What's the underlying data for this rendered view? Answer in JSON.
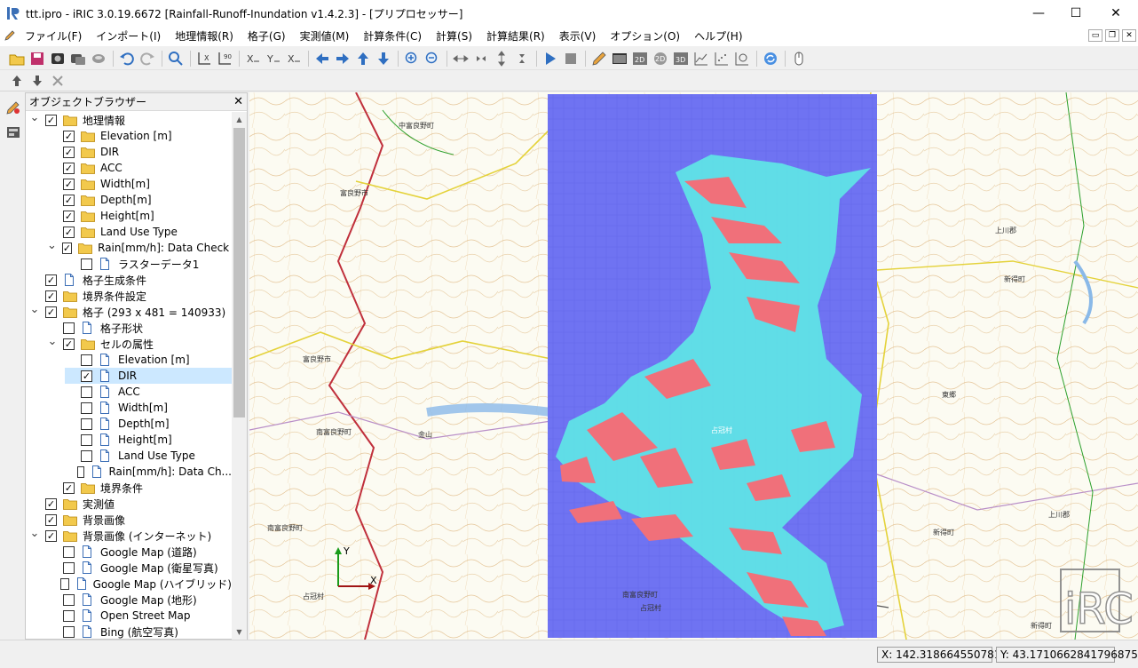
{
  "window": {
    "title": "ttt.ipro - iRIC 3.0.19.6672 [Rainfall-Runoff-Inundation v1.4.2.3] - [プリプロセッサー]",
    "controls": {
      "minimize": "—",
      "maximize": "☐",
      "close": "✕"
    }
  },
  "menu": [
    "ファイル(F)",
    "インポート(I)",
    "地理情報(R)",
    "格子(G)",
    "実測値(M)",
    "計算条件(C)",
    "計算(S)",
    "計算結果(R)",
    "表示(V)",
    "オプション(O)",
    "ヘルプ(H)"
  ],
  "object_browser": {
    "title": "オブジェクトブラウザー",
    "close": "✕",
    "items": [
      {
        "label": "地理情報",
        "level": 0,
        "expander": "v",
        "checked": true,
        "icon": "folder"
      },
      {
        "label": "Elevation [m]",
        "level": 1,
        "expander": "",
        "checked": true,
        "icon": "folder"
      },
      {
        "label": "DIR",
        "level": 1,
        "expander": "",
        "checked": true,
        "icon": "folder"
      },
      {
        "label": "ACC",
        "level": 1,
        "expander": "",
        "checked": true,
        "icon": "folder"
      },
      {
        "label": "Width[m]",
        "level": 1,
        "expander": "",
        "checked": true,
        "icon": "folder"
      },
      {
        "label": "Depth[m]",
        "level": 1,
        "expander": "",
        "checked": true,
        "icon": "folder"
      },
      {
        "label": "Height[m]",
        "level": 1,
        "expander": "",
        "checked": true,
        "icon": "folder"
      },
      {
        "label": "Land Use Type",
        "level": 1,
        "expander": "",
        "checked": true,
        "icon": "folder"
      },
      {
        "label": "Rain[mm/h]: Data Check ...",
        "level": 1,
        "expander": "v",
        "checked": true,
        "icon": "folder"
      },
      {
        "label": "ラスターデータ1",
        "level": 2,
        "expander": "",
        "checked": false,
        "icon": "file"
      },
      {
        "label": "格子生成条件",
        "level": 0,
        "expander": "",
        "checked": true,
        "icon": "file"
      },
      {
        "label": "境界条件設定",
        "level": 0,
        "expander": "",
        "checked": true,
        "icon": "folder"
      },
      {
        "label": "格子 (293 x 481 = 140933)",
        "level": 0,
        "expander": "v",
        "checked": true,
        "icon": "folder"
      },
      {
        "label": "格子形状",
        "level": 1,
        "expander": "",
        "checked": false,
        "icon": "file"
      },
      {
        "label": "セルの属性",
        "level": 1,
        "expander": "v",
        "checked": true,
        "icon": "folder"
      },
      {
        "label": "Elevation [m]",
        "level": 2,
        "expander": "",
        "checked": false,
        "icon": "file"
      },
      {
        "label": "DIR",
        "level": 2,
        "expander": "",
        "checked": true,
        "icon": "file",
        "selected": true
      },
      {
        "label": "ACC",
        "level": 2,
        "expander": "",
        "checked": false,
        "icon": "file"
      },
      {
        "label": "Width[m]",
        "level": 2,
        "expander": "",
        "checked": false,
        "icon": "file"
      },
      {
        "label": "Depth[m]",
        "level": 2,
        "expander": "",
        "checked": false,
        "icon": "file"
      },
      {
        "label": "Height[m]",
        "level": 2,
        "expander": "",
        "checked": false,
        "icon": "file"
      },
      {
        "label": "Land Use Type",
        "level": 2,
        "expander": "",
        "checked": false,
        "icon": "file"
      },
      {
        "label": "Rain[mm/h]: Data Ch...",
        "level": 2,
        "expander": "",
        "checked": false,
        "icon": "file"
      },
      {
        "label": "境界条件",
        "level": 1,
        "expander": "",
        "checked": true,
        "icon": "folder"
      },
      {
        "label": "実測値",
        "level": 0,
        "expander": "",
        "checked": true,
        "icon": "folder"
      },
      {
        "label": "背景画像",
        "level": 0,
        "expander": "",
        "checked": true,
        "icon": "folder"
      },
      {
        "label": "背景画像 (インターネット)",
        "level": 0,
        "expander": "v",
        "checked": true,
        "icon": "folder"
      },
      {
        "label": "Google Map (道路)",
        "level": 1,
        "expander": "",
        "checked": false,
        "icon": "file"
      },
      {
        "label": "Google Map (衛星写真)",
        "level": 1,
        "expander": "",
        "checked": false,
        "icon": "file"
      },
      {
        "label": "Google Map (ハイブリッド)",
        "level": 1,
        "expander": "",
        "checked": false,
        "icon": "file"
      },
      {
        "label": "Google Map (地形)",
        "level": 1,
        "expander": "",
        "checked": false,
        "icon": "file"
      },
      {
        "label": "Open Street Map",
        "level": 1,
        "expander": "",
        "checked": false,
        "icon": "file"
      },
      {
        "label": "Bing (航空写真)",
        "level": 1,
        "expander": "",
        "checked": false,
        "icon": "file"
      }
    ]
  },
  "map": {
    "axis_x": "X",
    "axis_y": "Y",
    "logo": "iRIC",
    "place_labels": [
      "中富良野町",
      "富良野市",
      "富良野市",
      "南富良野町",
      "金山",
      "占冠村",
      "南富良野町",
      "上川郡",
      "新得町",
      "占冠村",
      "南富良野町",
      "上川郡",
      "新得町",
      "新得町",
      "東郷",
      "占冠村"
    ]
  },
  "colors": {
    "raster_blue": "#6f73f2",
    "raster_cyan": "#5ee6e6",
    "raster_red": "#f0707a",
    "selection": "#cce8ff",
    "folder": "#f2c94c"
  },
  "status": {
    "x": "X: 142.31866455078125",
    "y": "Y: 43.1710662841796875"
  }
}
